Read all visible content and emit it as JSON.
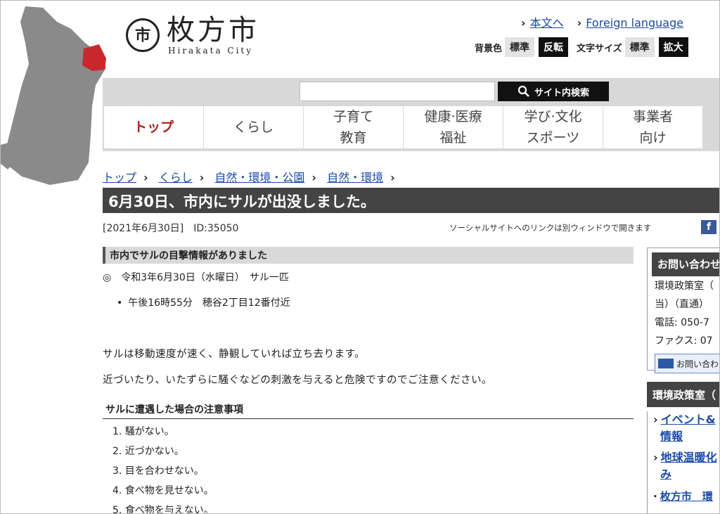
{
  "logo": {
    "mark": "市",
    "name_jp": "枚方市",
    "name_en": "Hirakata City"
  },
  "toplinks": {
    "main_text": "本文へ",
    "foreign": "Foreign language"
  },
  "toggles": {
    "bg_label": "背景色",
    "bg_standard": "標準",
    "bg_invert": "反転",
    "font_label": "文字サイズ",
    "font_standard": "標準",
    "font_large": "拡大"
  },
  "search": {
    "placeholder": "",
    "button": "サイト内検索"
  },
  "nav": [
    {
      "line1": "トップ",
      "line2": ""
    },
    {
      "line1": "くらし",
      "line2": ""
    },
    {
      "line1": "子育て",
      "line2": "教育"
    },
    {
      "line1": "健康·医療",
      "line2": "福祉"
    },
    {
      "line1": "学び·文化",
      "line2": "スポーツ"
    },
    {
      "line1": "事業者",
      "line2": "向け"
    }
  ],
  "breadcrumb": [
    "トップ",
    "くらし",
    "自然・環境・公園",
    "自然・環境"
  ],
  "page": {
    "title": "6月30日、市内にサルが出没しました。",
    "meta": "[2021年6月30日]　ID:35050",
    "social_note": "ソーシャルサイトへのリンクは別ウィンドウで開きます",
    "fb": "f"
  },
  "content": {
    "h3": "市内でサルの目撃情報がありました",
    "line1": "◎　令和3年6月30日（水曜日）　サル一匹",
    "bullet1": "午後16時55分　穂谷2丁目12番付近",
    "para1": "サルは移動速度が速く、静観していれば立ち去ります。",
    "para2": "近づいたり、いたずらに騒ぐなどの刺激を与えると危険ですのでご注意ください。",
    "h4": "サルに遭遇した場合の注意事項",
    "list": [
      "1. 騒がない。",
      "2. 近づかない。",
      "3. 目を合わせない。",
      "4. 食べ物を見せない。",
      "5. 食べ物を与えない。"
    ]
  },
  "sidebar": {
    "contact_head": "お問い合わせ",
    "contact_lines": [
      "環境政策室（",
      "当）（直通）",
      "電話: 050-7",
      "ファクス: 07"
    ],
    "inquiry_button": "お問い合わ",
    "dept_head": "環境政策室（",
    "links": [
      "イベント&",
      "情報",
      "地球温暖化",
      "み"
    ],
    "sub_link": "枚方市　環"
  },
  "colors": {
    "map_highlight": "#c8282d",
    "map_gray": "#8a8a8a",
    "link": "#1a4aa8"
  }
}
